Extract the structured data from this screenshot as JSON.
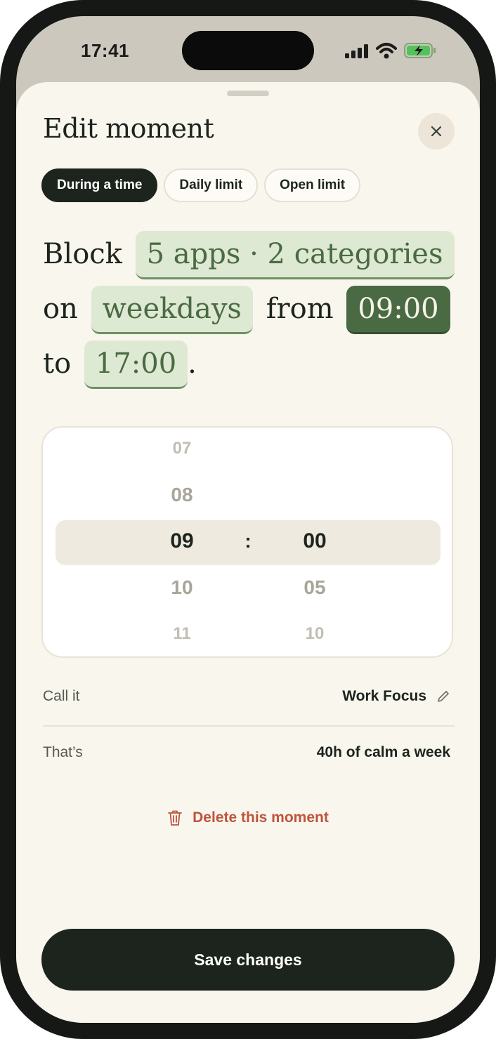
{
  "status": {
    "time": "17:41"
  },
  "sheet": {
    "title": "Edit moment",
    "tabs": [
      {
        "label": "During a time",
        "active": true
      },
      {
        "label": "Daily limit",
        "active": false
      },
      {
        "label": "Open limit",
        "active": false
      }
    ],
    "sentence": {
      "block": "Block",
      "apps_chip": "5 apps · 2 categories",
      "on": "on",
      "days_chip": "weekdays",
      "from": "from",
      "start_chip": "09:00",
      "to": "to",
      "end_chip": "17:00",
      "period": "."
    },
    "picker": {
      "hours": [
        "07",
        "08",
        "09",
        "10",
        "11"
      ],
      "minutes": [
        "00",
        "05",
        "10"
      ],
      "separator": ":"
    },
    "name_row": {
      "label": "Call it",
      "value": "Work Focus"
    },
    "summary_row": {
      "label": "That’s",
      "value": "40h of calm a week"
    },
    "delete_label": "Delete this moment",
    "save_label": "Save changes"
  },
  "colors": {
    "primary_dark": "#1c241d",
    "chip_bg": "#dde9d2",
    "chip_dark": "#4a6a43",
    "danger": "#c0533c",
    "sheet_bg": "#f9f6ee"
  },
  "icons": [
    "signal-icon",
    "wifi-icon",
    "battery-charging-icon",
    "close-icon",
    "pencil-icon",
    "trash-icon"
  ]
}
